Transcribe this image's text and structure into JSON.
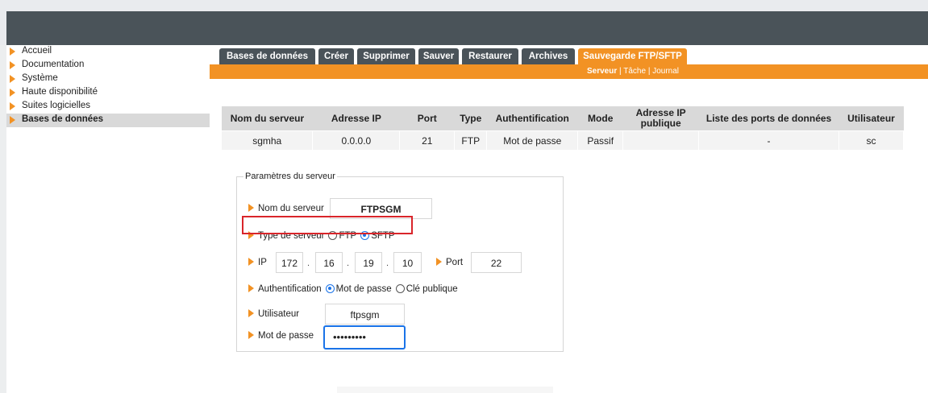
{
  "sidebar": {
    "items": [
      {
        "label": "Accueil",
        "active": false
      },
      {
        "label": "Documentation",
        "active": false
      },
      {
        "label": "Système",
        "active": false
      },
      {
        "label": "Haute disponibilité",
        "active": false
      },
      {
        "label": "Suites logicielles",
        "active": false
      },
      {
        "label": "Bases de données",
        "active": true
      }
    ]
  },
  "tabs": [
    {
      "label": "Bases de données",
      "active": false
    },
    {
      "label": "Créer",
      "active": false
    },
    {
      "label": "Supprimer",
      "active": false
    },
    {
      "label": "Sauver",
      "active": false
    },
    {
      "label": "Restaurer",
      "active": false
    },
    {
      "label": "Archives",
      "active": false
    },
    {
      "label": "Sauvegarde FTP/SFTP",
      "active": true
    }
  ],
  "subnav": {
    "server": "Serveur",
    "sep": "|",
    "task": "Tâche",
    "journal": "Journal"
  },
  "table": {
    "headers": [
      "Nom du serveur",
      "Adresse IP",
      "Port",
      "Type",
      "Authentification",
      "Mode",
      "Adresse IP publique",
      "Liste des ports de données",
      "Utilisateur"
    ],
    "row": [
      "sgmha",
      "0.0.0.0",
      "21",
      "FTP",
      "Mot de passe",
      "Passif",
      "",
      "-",
      "sc"
    ]
  },
  "form": {
    "legend": "Paramètres du serveur",
    "server_name_label": "Nom du serveur",
    "server_name_value": "FTPSGM",
    "server_type_label": "Type de serveur",
    "type_ftp": "FTP",
    "type_sftp": "SFTP",
    "selected_type": "SFTP",
    "ip_label": "IP",
    "ip_octets": [
      "172",
      "16",
      "19",
      "10"
    ],
    "ip_sep": ".",
    "port_label": "Port",
    "port_value": "22",
    "auth_label": "Authentification",
    "auth_password": "Mot de passe",
    "auth_key": "Clé publique",
    "selected_auth": "Mot de passe",
    "user_label": "Utilisateur",
    "user_value": "ftpsgm",
    "password_label": "Mot de passe",
    "password_value": "•••••••••"
  },
  "colors": {
    "accent": "#f29224",
    "header_bar": "#4a5359",
    "highlight": "#d9252a",
    "focus": "#1a73e8"
  }
}
